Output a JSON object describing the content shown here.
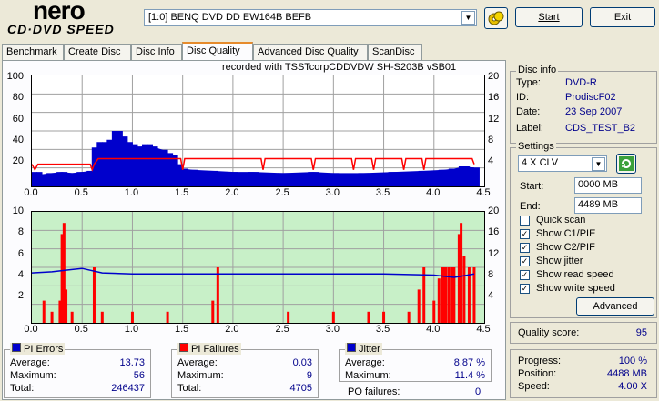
{
  "app": {
    "logo_top": "nero",
    "logo_bottom": "CD·DVD SPEED"
  },
  "toolbar": {
    "drive": "[1:0]  BENQ DVD DD EW164B BEFB",
    "start_label": "Start",
    "exit_label": "Exit"
  },
  "tabs": [
    "Benchmark",
    "Create Disc",
    "Disc Info",
    "Disc Quality",
    "Advanced Disc Quality",
    "ScanDisc"
  ],
  "active_tab": "Disc Quality",
  "recorded": "recorded with TSSTcorpCDDVDW SH-S203B   vSB01",
  "disc_info": {
    "title": "Disc info",
    "rows": [
      {
        "label": "Type:",
        "value": "DVD-R"
      },
      {
        "label": "ID:",
        "value": "ProdiscF02"
      },
      {
        "label": "Date:",
        "value": "23 Sep 2007"
      },
      {
        "label": "Label:",
        "value": "CDS_TEST_B2"
      }
    ]
  },
  "settings": {
    "title": "Settings",
    "speed": "4 X CLV",
    "start_label": "Start:",
    "start_value": "0000 MB",
    "end_label": "End:",
    "end_value": "4489 MB",
    "checks": [
      {
        "label": "Quick scan",
        "checked": false
      },
      {
        "label": "Show C1/PIE",
        "checked": true
      },
      {
        "label": "Show C2/PIF",
        "checked": true
      },
      {
        "label": "Show jitter",
        "checked": true
      },
      {
        "label": "Show read speed",
        "checked": true
      },
      {
        "label": "Show write speed",
        "checked": true
      }
    ],
    "advanced_label": "Advanced"
  },
  "quality": {
    "label": "Quality score:",
    "value": "95"
  },
  "progress": {
    "rows": [
      {
        "label": "Progress:",
        "value": "100 %"
      },
      {
        "label": "Position:",
        "value": "4488 MB"
      },
      {
        "label": "Speed:",
        "value": "4.00 X"
      }
    ]
  },
  "pi_errors": {
    "title": "PI Errors",
    "color": "#0000cc",
    "rows": [
      {
        "label": "Average:",
        "value": "13.73"
      },
      {
        "label": "Maximum:",
        "value": "56"
      },
      {
        "label": "Total:",
        "value": "246437"
      }
    ]
  },
  "pi_failures": {
    "title": "PI Failures",
    "color": "#ff0000",
    "rows": [
      {
        "label": "Average:",
        "value": "0.03"
      },
      {
        "label": "Maximum:",
        "value": "9"
      },
      {
        "label": "Total:",
        "value": "4705"
      }
    ]
  },
  "jitter": {
    "title": "Jitter",
    "color": "#0000cc",
    "rows": [
      {
        "label": "Average:",
        "value": "8.87 %"
      },
      {
        "label": "Maximum:",
        "value": "11.4 %"
      }
    ]
  },
  "po_failures": {
    "label": "PO failures:",
    "value": "0"
  },
  "chart_data": [
    {
      "type": "area",
      "title": "PI Errors",
      "x_ticks": [
        "0.0",
        "0.5",
        "1.0",
        "1.5",
        "2.0",
        "2.5",
        "3.0",
        "3.5",
        "4.0",
        "4.5"
      ],
      "y_left_ticks": [
        "100",
        "80",
        "60",
        "40",
        "20"
      ],
      "y_right_ticks": [
        "20",
        "16",
        "12",
        "8",
        "4"
      ],
      "xlim": [
        0,
        4.5
      ],
      "ylim": [
        0,
        100
      ],
      "y2lim": [
        0,
        20
      ],
      "pi_series_color": "#0000cc",
      "speed_color": "#ff0000",
      "pi_points": [
        [
          0,
          10
        ],
        [
          0.05,
          13
        ],
        [
          0.1,
          11
        ],
        [
          0.2,
          12
        ],
        [
          0.3,
          13
        ],
        [
          0.4,
          12
        ],
        [
          0.5,
          13
        ],
        [
          0.6,
          14
        ],
        [
          0.65,
          35
        ],
        [
          0.7,
          40
        ],
        [
          0.75,
          38
        ],
        [
          0.8,
          42
        ],
        [
          0.85,
          50
        ],
        [
          0.9,
          45
        ],
        [
          0.95,
          40
        ],
        [
          1.0,
          38
        ],
        [
          1.05,
          35
        ],
        [
          1.1,
          36
        ],
        [
          1.15,
          38
        ],
        [
          1.2,
          36
        ],
        [
          1.3,
          33
        ],
        [
          1.35,
          30
        ],
        [
          1.4,
          28
        ],
        [
          1.45,
          20
        ],
        [
          1.5,
          16
        ],
        [
          1.6,
          15
        ],
        [
          1.8,
          14
        ],
        [
          2.0,
          13
        ],
        [
          2.2,
          13
        ],
        [
          2.5,
          12
        ],
        [
          2.8,
          13
        ],
        [
          3.0,
          12
        ],
        [
          3.3,
          12
        ],
        [
          3.6,
          13
        ],
        [
          3.9,
          14
        ],
        [
          4.1,
          15
        ],
        [
          4.2,
          16
        ],
        [
          4.3,
          18
        ],
        [
          4.4,
          17
        ]
      ],
      "speed_points": [
        [
          0,
          4
        ],
        [
          0.03,
          3
        ],
        [
          0.06,
          4
        ],
        [
          0.58,
          4
        ],
        [
          0.6,
          3
        ],
        [
          0.62,
          4
        ],
        [
          0.66,
          5
        ],
        [
          1.48,
          5
        ],
        [
          1.5,
          3
        ],
        [
          1.52,
          5
        ],
        [
          2.28,
          5
        ],
        [
          2.3,
          3
        ],
        [
          2.32,
          5
        ],
        [
          2.78,
          5
        ],
        [
          2.8,
          3
        ],
        [
          2.82,
          5
        ],
        [
          3.18,
          5
        ],
        [
          3.2,
          3
        ],
        [
          3.22,
          5
        ],
        [
          3.38,
          5
        ],
        [
          3.4,
          3
        ],
        [
          3.42,
          5
        ],
        [
          3.68,
          5
        ],
        [
          3.7,
          3
        ],
        [
          3.72,
          5
        ],
        [
          3.88,
          5
        ],
        [
          3.9,
          3
        ],
        [
          3.92,
          5
        ],
        [
          4.38,
          5
        ],
        [
          4.4,
          4
        ]
      ]
    },
    {
      "type": "bar",
      "title": "PI Failures / Jitter",
      "x_ticks": [
        "0.0",
        "0.5",
        "1.0",
        "1.5",
        "2.0",
        "2.5",
        "3.0",
        "3.5",
        "4.0",
        "4.5"
      ],
      "y_left_ticks": [
        "10",
        "8",
        "6",
        "4",
        "2"
      ],
      "y_right_ticks": [
        "20",
        "16",
        "12",
        "8",
        "4"
      ],
      "xlim": [
        0,
        4.5
      ],
      "ylim": [
        0,
        10
      ],
      "y2lim": [
        0,
        20
      ],
      "pif_color": "#ff0000",
      "jitter_color": "#0000cc",
      "pif_bars": [
        [
          0.12,
          2
        ],
        [
          0.2,
          1
        ],
        [
          0.28,
          2
        ],
        [
          0.3,
          8
        ],
        [
          0.32,
          9
        ],
        [
          0.34,
          3
        ],
        [
          0.4,
          1
        ],
        [
          0.62,
          5
        ],
        [
          0.7,
          1
        ],
        [
          1.0,
          1
        ],
        [
          1.35,
          1
        ],
        [
          1.8,
          2
        ],
        [
          1.85,
          5
        ],
        [
          2.55,
          1
        ],
        [
          3.0,
          1
        ],
        [
          3.35,
          1
        ],
        [
          3.5,
          1
        ],
        [
          3.75,
          1
        ],
        [
          3.85,
          3
        ],
        [
          3.9,
          5
        ],
        [
          4.0,
          2
        ],
        [
          4.05,
          4
        ],
        [
          4.08,
          5
        ],
        [
          4.1,
          5
        ],
        [
          4.12,
          5
        ],
        [
          4.15,
          5
        ],
        [
          4.18,
          5
        ],
        [
          4.2,
          5
        ],
        [
          4.25,
          8
        ],
        [
          4.27,
          9
        ],
        [
          4.3,
          6
        ],
        [
          4.35,
          5
        ],
        [
          4.4,
          5
        ]
      ],
      "jitter_points": [
        [
          0,
          9.0
        ],
        [
          0.2,
          9.2
        ],
        [
          0.4,
          9.6
        ],
        [
          0.5,
          9.8
        ],
        [
          0.7,
          9.0
        ],
        [
          1.0,
          8.8
        ],
        [
          1.5,
          8.8
        ],
        [
          2.0,
          8.8
        ],
        [
          2.5,
          8.8
        ],
        [
          3.0,
          8.8
        ],
        [
          3.5,
          8.8
        ],
        [
          4.0,
          8.6
        ],
        [
          4.2,
          8.2
        ],
        [
          4.4,
          8.8
        ]
      ]
    }
  ]
}
